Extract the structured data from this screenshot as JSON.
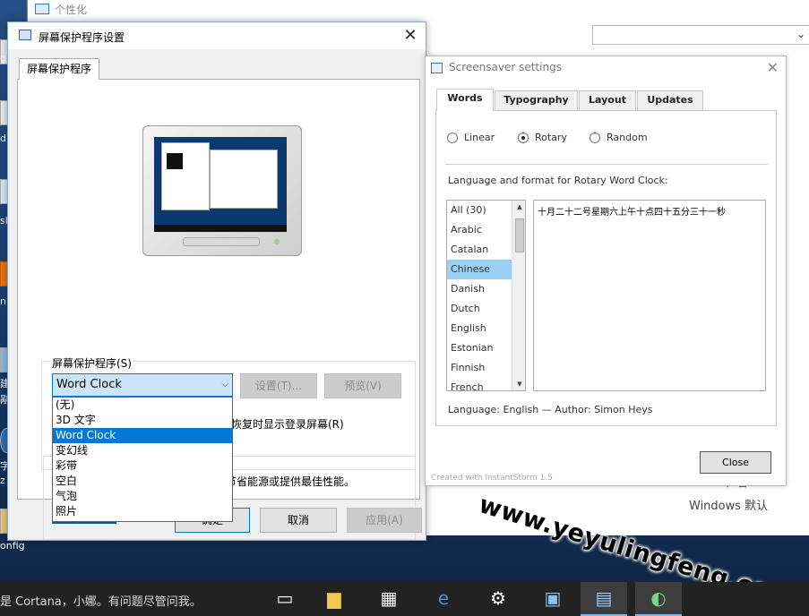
{
  "background_window": {
    "title": "个性化",
    "sound_label": "声音",
    "sound_value": "Windows 默认"
  },
  "desktop": {
    "labels": [
      "gp",
      "dr",
      "sla",
      "nn",
      "建",
      "剐",
      "字彭",
      "z",
      "onfig"
    ]
  },
  "screensaver_dialog": {
    "title": "屏幕保护程序设置",
    "tab": "屏幕保护程序",
    "group_label": "屏幕保护程序(S)",
    "combo_value": "Word Clock",
    "settings_button": "设置(T)...",
    "preview_button": "预览(V)",
    "dropdown_options": [
      "(无)",
      "3D 文字",
      "Word Clock",
      "变幻线",
      "彩带",
      "空白",
      "气泡",
      "照片"
    ],
    "selected_option": "Word Clock",
    "resume_text": "恢复时显示登录屏幕(R)",
    "power_text": "节省能源或提供最佳性能。",
    "ok_button": "确定",
    "cancel_button": "取消",
    "apply_button": "应用(A)"
  },
  "wordclock_dialog": {
    "title": "Screensaver settings",
    "tabs": [
      "Words",
      "Typography",
      "Layout",
      "Updates"
    ],
    "active_tab": "Words",
    "radio_options": [
      "Linear",
      "Rotary",
      "Random"
    ],
    "selected_radio": "Rotary",
    "language_label": "Language and format for Rotary Word Clock:",
    "languages": [
      "All (30)",
      "Arabic",
      "Catalan",
      "Chinese",
      "Danish",
      "Dutch",
      "English",
      "Estonian",
      "Finnish",
      "French"
    ],
    "selected_language": "Chinese",
    "clock_text": "十月二十二号星期六上午十点四十五分三十一秒",
    "language_info": "Language: English — Author: Simon Heys",
    "created_with": "Created with InstantStorm 1.5",
    "close_button": "Close"
  },
  "taskbar": {
    "cortana_text": "是 Cortana，小娜。有问题尽管问我。"
  },
  "watermark": "www.yeyulingfeng.com",
  "colors": {
    "accent": "#0078d7",
    "selection_light": "#99d1f4",
    "combo_highlight": "#cce4f7",
    "taskbar": "#222222"
  }
}
